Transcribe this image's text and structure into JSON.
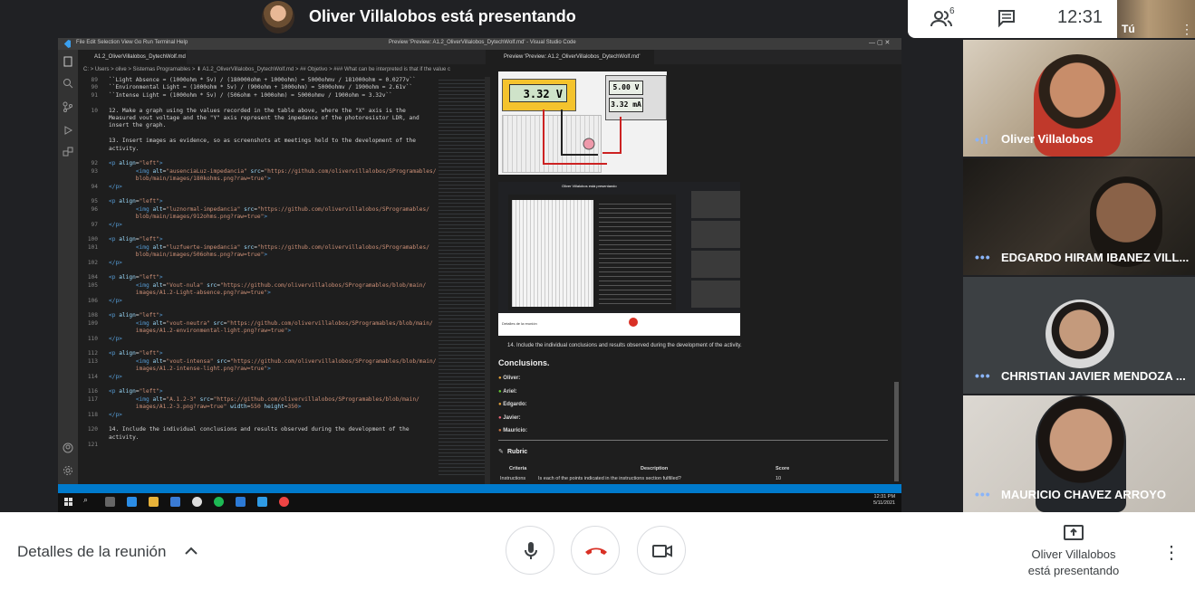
{
  "top_bar": {
    "presenting_title": "Oliver Villalobos está presentando",
    "participant_count": "6",
    "clock": "12:31",
    "self_label": "Tú"
  },
  "shared_screen": {
    "vscode": {
      "menu": "File   Edit   Selection   View   Go   Run   Terminal   Help",
      "window_title": "Preview 'Preview: A1.2_OliverVillalobos_DytechWolf.md' - Visual Studio Code",
      "tab": "A1.2_OliverVillalobos_DytechWolf.md",
      "breadcrumb": "C: > Users > olive > Sistemas Programables > ⬇ A1.2_OliverVillalobos_DytechWolf.md > ## Objetivo > ### What can be interpreted is that if the value c",
      "code_lines": [
        {
          "n": "89",
          "parts": [
            {
              "c": "txt",
              "t": "``Light Absence = (1000ohm * 5v) / (180000ohm + 1000ohm) = 5000ohmv / 181000ohm = 0.0277v``"
            }
          ]
        },
        {
          "n": "90",
          "parts": [
            {
              "c": "txt",
              "t": "``Environmental Light = (1000ohm * 5v) / (900ohm + 1000ohm) = 5000ohmv / 1900ohm = 2.61v``"
            }
          ]
        },
        {
          "n": "91",
          "parts": [
            {
              "c": "txt",
              "t": "``Intense Light = (1000ohm * 5v) / (506ohm + 1000ohm) = 5000ohmv / 1900ohm = 3.32v``"
            }
          ]
        },
        {
          "n": "",
          "parts": []
        },
        {
          "n": "10",
          "parts": [
            {
              "c": "txt",
              "t": "12. Make a graph using the values recorded in the table above, where the \"X\" axis is the"
            }
          ]
        },
        {
          "n": "",
          "parts": [
            {
              "c": "txt",
              "t": "Measured vout voltage and the \"Y\" axis represent the impedance of the photoresistor LDR, and"
            }
          ]
        },
        {
          "n": "",
          "parts": [
            {
              "c": "txt",
              "t": "insert the graph."
            }
          ]
        },
        {
          "n": "",
          "parts": []
        },
        {
          "n": "",
          "parts": [
            {
              "c": "txt",
              "t": "13. Insert images as evidence, so as screenshots at meetings held to the development of the"
            }
          ]
        },
        {
          "n": "",
          "parts": [
            {
              "c": "txt",
              "t": "activity."
            }
          ]
        },
        {
          "n": "",
          "parts": []
        },
        {
          "n": "92",
          "parts": [
            {
              "c": "tag",
              "t": "<p "
            },
            {
              "c": "attr",
              "t": "align"
            },
            {
              "c": "txt",
              "t": "="
            },
            {
              "c": "str",
              "t": "\"left\""
            },
            {
              "c": "tag",
              "t": ">"
            }
          ]
        },
        {
          "n": "93",
          "parts": [
            {
              "c": "txt",
              "t": "        "
            },
            {
              "c": "tag",
              "t": "<img "
            },
            {
              "c": "attr",
              "t": "alt"
            },
            {
              "c": "txt",
              "t": "="
            },
            {
              "c": "str",
              "t": "\"ausenciaLuz-impedancia\""
            },
            {
              "c": "txt",
              "t": " "
            },
            {
              "c": "attr",
              "t": "src"
            },
            {
              "c": "txt",
              "t": "="
            },
            {
              "c": "str",
              "t": "\"https://github.com/olivervillalobos/SProgramables/"
            }
          ]
        },
        {
          "n": "",
          "parts": [
            {
              "c": "str",
              "t": "        blob/main/images/180kohms.png?raw=true\""
            },
            {
              "c": "tag",
              "t": ">"
            }
          ]
        },
        {
          "n": "94",
          "parts": [
            {
              "c": "tag",
              "t": "</p>"
            }
          ]
        },
        {
          "n": "",
          "parts": []
        },
        {
          "n": "95",
          "parts": [
            {
              "c": "tag",
              "t": "<p "
            },
            {
              "c": "attr",
              "t": "align"
            },
            {
              "c": "txt",
              "t": "="
            },
            {
              "c": "str",
              "t": "\"left\""
            },
            {
              "c": "tag",
              "t": ">"
            }
          ]
        },
        {
          "n": "96",
          "parts": [
            {
              "c": "txt",
              "t": "        "
            },
            {
              "c": "tag",
              "t": "<img "
            },
            {
              "c": "attr",
              "t": "alt"
            },
            {
              "c": "txt",
              "t": "="
            },
            {
              "c": "str",
              "t": "\"luznormal-impedancia\""
            },
            {
              "c": "txt",
              "t": " "
            },
            {
              "c": "attr",
              "t": "src"
            },
            {
              "c": "txt",
              "t": "="
            },
            {
              "c": "str",
              "t": "\"https://github.com/olivervillalobos/SProgramables/"
            }
          ]
        },
        {
          "n": "",
          "parts": [
            {
              "c": "str",
              "t": "        blob/main/images/912ohms.png?raw=true\""
            },
            {
              "c": "tag",
              "t": ">"
            }
          ]
        },
        {
          "n": "97",
          "parts": [
            {
              "c": "tag",
              "t": "</p>"
            }
          ]
        },
        {
          "n": "",
          "parts": []
        },
        {
          "n": "100",
          "parts": [
            {
              "c": "tag",
              "t": "<p "
            },
            {
              "c": "attr",
              "t": "align"
            },
            {
              "c": "txt",
              "t": "="
            },
            {
              "c": "str",
              "t": "\"left\""
            },
            {
              "c": "tag",
              "t": ">"
            }
          ]
        },
        {
          "n": "101",
          "parts": [
            {
              "c": "txt",
              "t": "        "
            },
            {
              "c": "tag",
              "t": "<img "
            },
            {
              "c": "attr",
              "t": "alt"
            },
            {
              "c": "txt",
              "t": "="
            },
            {
              "c": "str",
              "t": "\"luzfuerte-impedancia\""
            },
            {
              "c": "txt",
              "t": " "
            },
            {
              "c": "attr",
              "t": "src"
            },
            {
              "c": "txt",
              "t": "="
            },
            {
              "c": "str",
              "t": "\"https://github.com/olivervillalobos/SProgramables/"
            }
          ]
        },
        {
          "n": "",
          "parts": [
            {
              "c": "str",
              "t": "        blob/main/images/506ohms.png?raw=true\""
            },
            {
              "c": "tag",
              "t": ">"
            }
          ]
        },
        {
          "n": "102",
          "parts": [
            {
              "c": "tag",
              "t": "</p>"
            }
          ]
        },
        {
          "n": "",
          "parts": []
        },
        {
          "n": "104",
          "parts": [
            {
              "c": "tag",
              "t": "<p "
            },
            {
              "c": "attr",
              "t": "align"
            },
            {
              "c": "txt",
              "t": "="
            },
            {
              "c": "str",
              "t": "\"left\""
            },
            {
              "c": "tag",
              "t": ">"
            }
          ]
        },
        {
          "n": "105",
          "parts": [
            {
              "c": "txt",
              "t": "        "
            },
            {
              "c": "tag",
              "t": "<img "
            },
            {
              "c": "attr",
              "t": "alt"
            },
            {
              "c": "txt",
              "t": "="
            },
            {
              "c": "str",
              "t": "\"Vout-nula\""
            },
            {
              "c": "txt",
              "t": " "
            },
            {
              "c": "attr",
              "t": "src"
            },
            {
              "c": "txt",
              "t": "="
            },
            {
              "c": "str",
              "t": "\"https://github.com/olivervillalobos/SProgramables/blob/main/"
            }
          ]
        },
        {
          "n": "",
          "parts": [
            {
              "c": "str",
              "t": "        images/A1.2-Light-absence.png?raw=true\""
            },
            {
              "c": "tag",
              "t": ">"
            }
          ]
        },
        {
          "n": "106",
          "parts": [
            {
              "c": "tag",
              "t": "</p>"
            }
          ]
        },
        {
          "n": "",
          "parts": []
        },
        {
          "n": "108",
          "parts": [
            {
              "c": "tag",
              "t": "<p "
            },
            {
              "c": "attr",
              "t": "align"
            },
            {
              "c": "txt",
              "t": "="
            },
            {
              "c": "str",
              "t": "\"left\""
            },
            {
              "c": "tag",
              "t": ">"
            }
          ]
        },
        {
          "n": "109",
          "parts": [
            {
              "c": "txt",
              "t": "        "
            },
            {
              "c": "tag",
              "t": "<img "
            },
            {
              "c": "attr",
              "t": "alt"
            },
            {
              "c": "txt",
              "t": "="
            },
            {
              "c": "str",
              "t": "\"vout-neutra\""
            },
            {
              "c": "txt",
              "t": " "
            },
            {
              "c": "attr",
              "t": "src"
            },
            {
              "c": "txt",
              "t": "="
            },
            {
              "c": "str",
              "t": "\"https://github.com/olivervillalobos/SProgramables/blob/main/"
            }
          ]
        },
        {
          "n": "",
          "parts": [
            {
              "c": "str",
              "t": "        images/A1.2-environmental-light.png?raw=true\""
            },
            {
              "c": "tag",
              "t": ">"
            }
          ]
        },
        {
          "n": "110",
          "parts": [
            {
              "c": "tag",
              "t": "</p>"
            }
          ]
        },
        {
          "n": "",
          "parts": []
        },
        {
          "n": "112",
          "parts": [
            {
              "c": "tag",
              "t": "<p "
            },
            {
              "c": "attr",
              "t": "align"
            },
            {
              "c": "txt",
              "t": "="
            },
            {
              "c": "str",
              "t": "\"left\""
            },
            {
              "c": "tag",
              "t": ">"
            }
          ]
        },
        {
          "n": "113",
          "parts": [
            {
              "c": "txt",
              "t": "        "
            },
            {
              "c": "tag",
              "t": "<img "
            },
            {
              "c": "attr",
              "t": "alt"
            },
            {
              "c": "txt",
              "t": "="
            },
            {
              "c": "str",
              "t": "\"vout-intensa\""
            },
            {
              "c": "txt",
              "t": " "
            },
            {
              "c": "attr",
              "t": "src"
            },
            {
              "c": "txt",
              "t": "="
            },
            {
              "c": "str",
              "t": "\"https://github.com/olivervillalobos/SProgramables/blob/main/"
            }
          ]
        },
        {
          "n": "",
          "parts": [
            {
              "c": "str",
              "t": "        images/A1.2-intense-light.png?raw=true\""
            },
            {
              "c": "tag",
              "t": ">"
            }
          ]
        },
        {
          "n": "114",
          "parts": [
            {
              "c": "tag",
              "t": "</p>"
            }
          ]
        },
        {
          "n": "",
          "parts": []
        },
        {
          "n": "116",
          "parts": [
            {
              "c": "tag",
              "t": "<p "
            },
            {
              "c": "attr",
              "t": "align"
            },
            {
              "c": "txt",
              "t": "="
            },
            {
              "c": "str",
              "t": "\"left\""
            },
            {
              "c": "tag",
              "t": ">"
            }
          ]
        },
        {
          "n": "117",
          "parts": [
            {
              "c": "txt",
              "t": "        "
            },
            {
              "c": "tag",
              "t": "<img "
            },
            {
              "c": "attr",
              "t": "alt"
            },
            {
              "c": "txt",
              "t": "="
            },
            {
              "c": "str",
              "t": "\"A.1.2-3\""
            },
            {
              "c": "txt",
              "t": " "
            },
            {
              "c": "attr",
              "t": "src"
            },
            {
              "c": "txt",
              "t": "="
            },
            {
              "c": "str",
              "t": "\"https://github.com/olivervillalobos/SProgramables/blob/main/"
            }
          ]
        },
        {
          "n": "",
          "parts": [
            {
              "c": "str",
              "t": "        images/A1.2-3.png?raw=true\""
            },
            {
              "c": "txt",
              "t": " "
            },
            {
              "c": "attr",
              "t": "width"
            },
            {
              "c": "txt",
              "t": "="
            },
            {
              "c": "str",
              "t": "550"
            },
            {
              "c": "txt",
              "t": " "
            },
            {
              "c": "attr",
              "t": "height"
            },
            {
              "c": "txt",
              "t": "="
            },
            {
              "c": "str",
              "t": "350"
            },
            {
              "c": "tag",
              "t": ">"
            }
          ]
        },
        {
          "n": "118",
          "parts": [
            {
              "c": "tag",
              "t": "</p>"
            }
          ]
        },
        {
          "n": "",
          "parts": []
        },
        {
          "n": "120",
          "parts": [
            {
              "c": "txt",
              "t": "14. Include the individual conclusions and results observed during the development of the"
            }
          ]
        },
        {
          "n": "",
          "parts": [
            {
              "c": "txt",
              "t": "activity."
            }
          ]
        },
        {
          "n": "121",
          "parts": []
        }
      ]
    },
    "preview": {
      "tab": "Preview 'Preview: A1.2_OliverVillalobos_DytechWolf.md'",
      "multimeter": "3.32 V",
      "supply_voltage": "5.00 V",
      "supply_current": "3.32 mA",
      "meeting_title": "Oliver Villalobos está presentando",
      "meeting_details": "Detalles de la reunión",
      "step14": "14. Include the individual conclusions and results observed during the development of the activity.",
      "conclusions_title": "Conclusions.",
      "conclusions": [
        "Oliver:",
        "Ariel:",
        "Edgardo:",
        "Javier:",
        "Mauricio:"
      ],
      "rubric_title": "Rubric",
      "rubric_headers": [
        "Criteria",
        "Description",
        "Score"
      ],
      "rubric_row": [
        "Instructions",
        "Is each of the points indicated in the instructions section fulfilled?",
        "10"
      ]
    },
    "taskbar": {
      "time": "12:31 PM",
      "date": "5/11/2021"
    }
  },
  "participants": [
    {
      "name": "Oliver Villalobos"
    },
    {
      "name": "EDGARDO HIRAM IBANEZ VILL..."
    },
    {
      "name": "CHRISTIAN JAVIER MENDOZA ..."
    },
    {
      "name": "MAURICIO CHAVEZ ARROYO"
    }
  ],
  "bottom_bar": {
    "meeting_details": "Detalles de la reunión",
    "presenting_line1": "Oliver Villalobos",
    "presenting_line2": "está presentando"
  },
  "colors": {
    "end_call": "#d93025",
    "accent": "#8ab4f8",
    "vscode_blue": "#007acc"
  }
}
